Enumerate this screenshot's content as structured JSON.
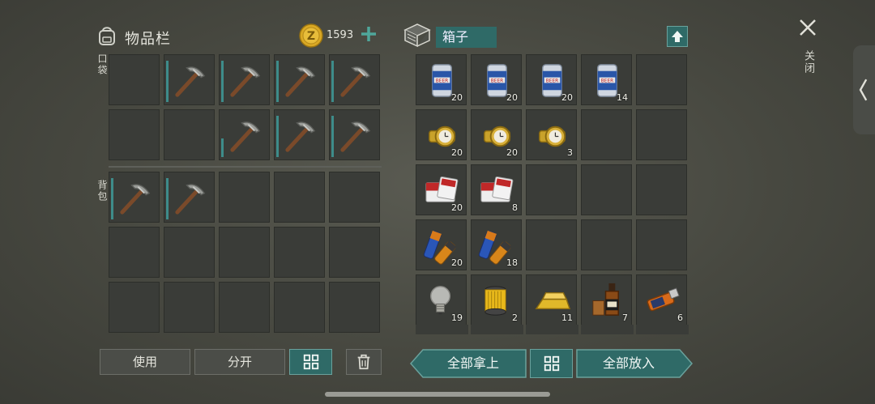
{
  "inventory": {
    "title": "物品栏",
    "coins": "1593",
    "pocket_label": "口袋",
    "backpack_label": "背包",
    "pocket_slots": [
      {
        "item": "empty"
      },
      {
        "item": "pickaxe",
        "durability": 0.9
      },
      {
        "item": "pickaxe",
        "durability": 0.9
      },
      {
        "item": "pickaxe",
        "durability": 0.9
      },
      {
        "item": "pickaxe",
        "durability": 0.9
      },
      {
        "item": "empty"
      },
      {
        "item": "empty"
      },
      {
        "item": "pickaxe",
        "durability": 0.4
      },
      {
        "item": "pickaxe",
        "durability": 0.9
      },
      {
        "item": "pickaxe",
        "durability": 0.9
      }
    ],
    "backpack_slots": [
      {
        "item": "pickaxe",
        "durability": 0.9
      },
      {
        "item": "pickaxe",
        "durability": 0.9
      },
      {
        "item": "empty"
      },
      {
        "item": "empty"
      },
      {
        "item": "empty"
      },
      {
        "item": "empty"
      },
      {
        "item": "empty"
      },
      {
        "item": "empty"
      },
      {
        "item": "empty"
      },
      {
        "item": "empty"
      },
      {
        "item": "empty"
      },
      {
        "item": "empty"
      },
      {
        "item": "empty"
      },
      {
        "item": "empty"
      },
      {
        "item": "empty"
      }
    ],
    "use_button": "使用",
    "split_button": "分开"
  },
  "box": {
    "title": "箱子",
    "slots": [
      {
        "item": "beer",
        "count": "20"
      },
      {
        "item": "beer",
        "count": "20"
      },
      {
        "item": "beer",
        "count": "20"
      },
      {
        "item": "beer",
        "count": "14"
      },
      {
        "item": "empty"
      },
      {
        "item": "watch",
        "count": "20"
      },
      {
        "item": "watch",
        "count": "20"
      },
      {
        "item": "watch",
        "count": "3"
      },
      {
        "item": "empty"
      },
      {
        "item": "empty"
      },
      {
        "item": "cigarettes",
        "count": "20"
      },
      {
        "item": "cigarettes",
        "count": "8"
      },
      {
        "item": "empty"
      },
      {
        "item": "empty"
      },
      {
        "item": "empty"
      },
      {
        "item": "batteries",
        "count": "20"
      },
      {
        "item": "batteries",
        "count": "18"
      },
      {
        "item": "empty"
      },
      {
        "item": "empty"
      },
      {
        "item": "empty"
      },
      {
        "item": "lightbulb",
        "count": "19"
      },
      {
        "item": "filter",
        "count": "2"
      },
      {
        "item": "gold-bar",
        "count": "11"
      },
      {
        "item": "whiskey",
        "count": "7"
      },
      {
        "item": "usb-drive",
        "count": "6"
      }
    ],
    "take_all_button": "全部拿上",
    "put_all_button": "全部放入"
  },
  "close_label": "关闭",
  "colors": {
    "accent": "#2f6a67",
    "accent_border": "#6aa19c",
    "slot": "#3a3c38",
    "durability": "#3e8c8a"
  }
}
